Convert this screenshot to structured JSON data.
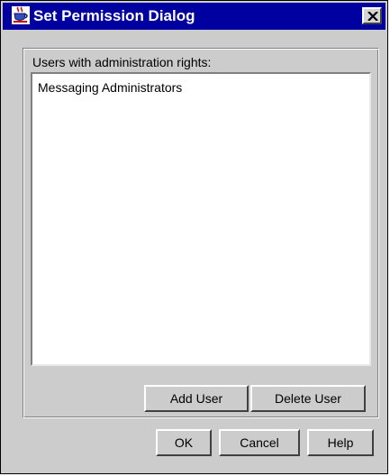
{
  "window": {
    "title": "Set Permission Dialog",
    "close_label": "×"
  },
  "colors": {
    "titlebar": "#0000a0",
    "dialog_background": "#cccccc",
    "list_background": "#ffffff"
  },
  "icons": {
    "title_icon": "java-cup-icon",
    "close_icon": "close-icon"
  },
  "permissions": {
    "list_label": "Users with administration rights:",
    "users": [
      "Messaging Administrators"
    ],
    "add_user_label": "Add User",
    "delete_user_label": "Delete User"
  },
  "footer": {
    "ok_label": "OK",
    "cancel_label": "Cancel",
    "help_label": "Help"
  }
}
